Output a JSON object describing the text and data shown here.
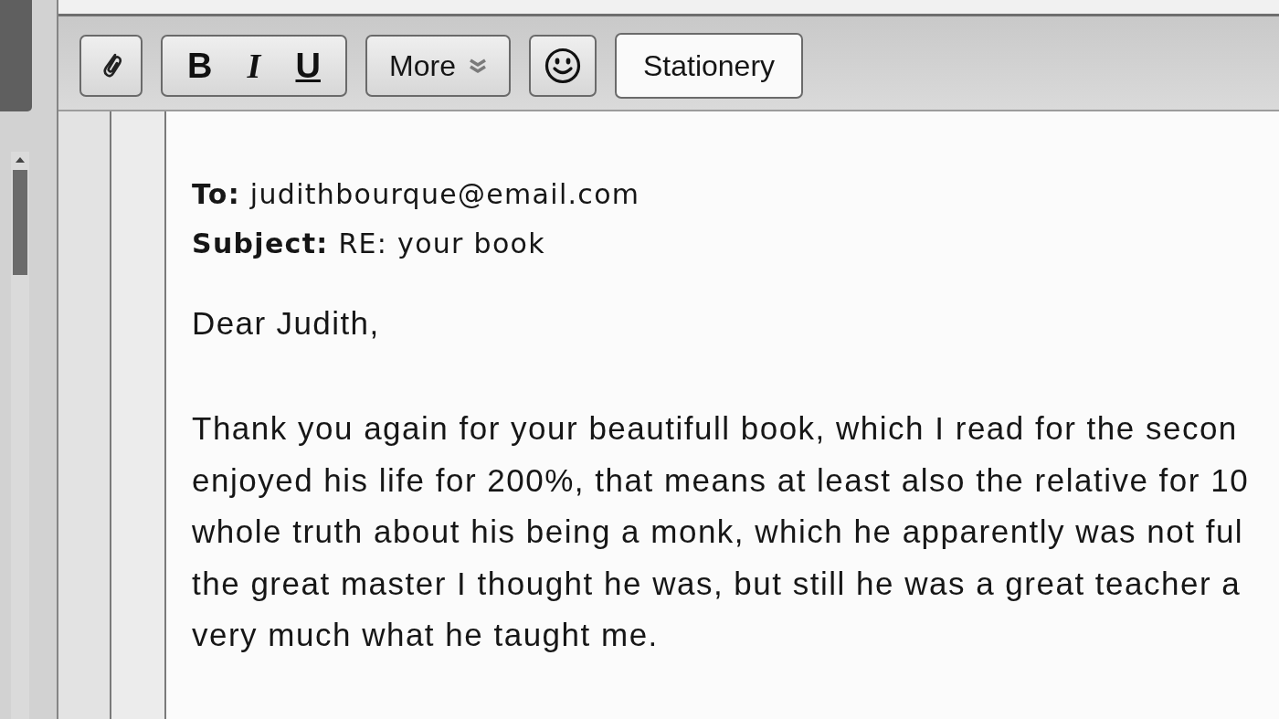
{
  "toolbar": {
    "format_buttons": [
      {
        "label": "B",
        "kind": "bold"
      },
      {
        "label": "I",
        "kind": "italic"
      },
      {
        "label": "U",
        "kind": "underline"
      }
    ],
    "more_button": "More",
    "stationery_button": "Stationery"
  },
  "message": {
    "to": {
      "label": "To:",
      "value": "judithbourque@email.com"
    },
    "subject": {
      "label": "Subject:",
      "value": "RE: your book"
    },
    "greeting": "Dear Judith,",
    "body_lines": [
      "Thank you again for your beautifull book, which I read for the secon",
      "enjoyed his life for 200%, that means at least also the relative for 10",
      "whole truth about his being a monk, which he apparently was not ful",
      "the great master I thought he was, but still he was a great teacher a",
      "very much what he taught me."
    ]
  }
}
